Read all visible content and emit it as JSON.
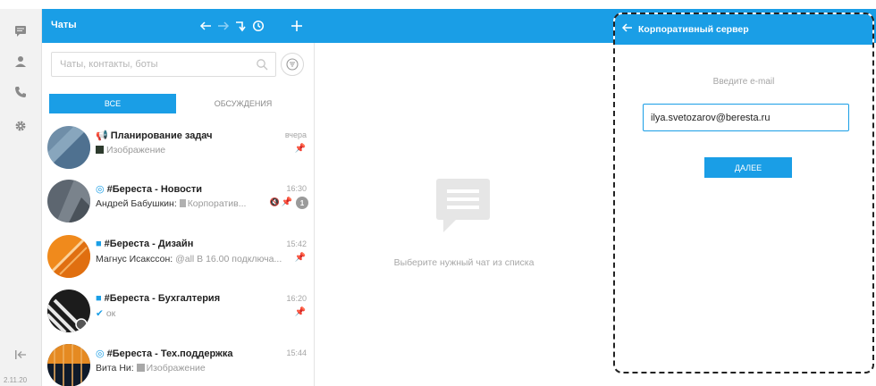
{
  "sidebar": {
    "icons": [
      "chat-icon",
      "user-icon",
      "phone-icon",
      "gear-icon",
      "collapse-icon"
    ],
    "time": "2.11.20"
  },
  "header": {
    "title": "Чаты"
  },
  "search": {
    "placeholder": "Чаты, контакты, боты"
  },
  "tabs": [
    {
      "label": "ВСЕ",
      "active": true
    },
    {
      "label": "ОБСУЖДЕНИЯ",
      "active": false
    }
  ],
  "chats": [
    {
      "title": "Планирование задач",
      "type_icon": "broadcast-icon",
      "time": "вчера",
      "sender": "",
      "preview": "Изображение",
      "badge": ""
    },
    {
      "title": "#Береста - Новости",
      "type_icon": "globe-icon",
      "time": "16:30",
      "sender": "Андрей Бабушкин:",
      "preview": "Корпоратив...",
      "badge": "1"
    },
    {
      "title": "#Береста - Дизайн",
      "type_icon": "briefcase-icon",
      "time": "15:42",
      "sender": "Магнус Исакссон:",
      "preview": "@all В 16.00 подключа...",
      "badge": ""
    },
    {
      "title": "#Береста - Бухгалтерия",
      "type_icon": "briefcase-icon",
      "time": "16:20",
      "sender": "",
      "preview": "ок",
      "badge": ""
    },
    {
      "title": "#Береста - Тех.поддержка",
      "type_icon": "globe-icon",
      "time": "15:44",
      "sender": "Вита Ни:",
      "preview": "Изображение",
      "badge": ""
    }
  ],
  "center": {
    "empty_text": "Выберите нужный чат из списка"
  },
  "panel": {
    "title": "Корпоративный сервер",
    "label": "Введите e-mail",
    "email_value": "ilya.svetozarov@beresta.ru",
    "button_label": "ДАЛЕЕ"
  },
  "colors": {
    "accent": "#1a9ee6"
  }
}
